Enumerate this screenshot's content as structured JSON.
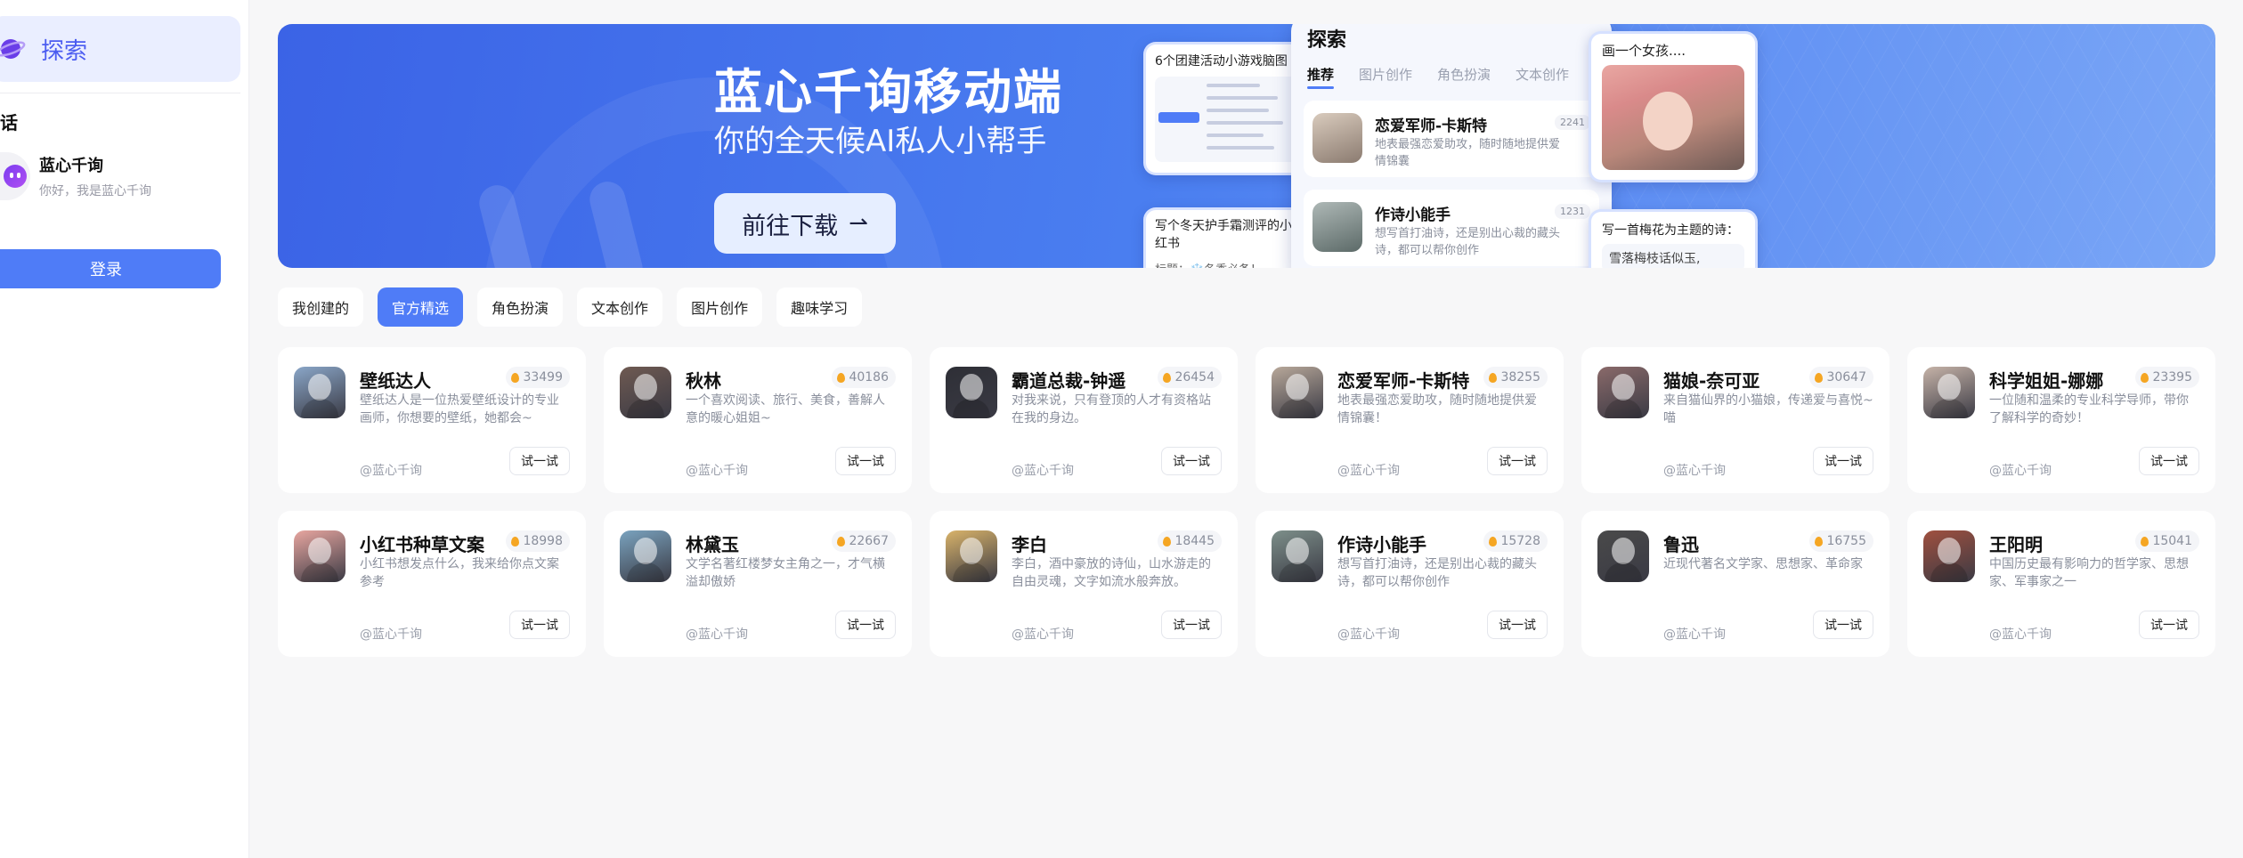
{
  "sidebar": {
    "explore_label": "探索",
    "section_title": "话",
    "chat": {
      "name": "蓝心千询",
      "subtitle": "你好，我是蓝心千询"
    },
    "login_label": "登录"
  },
  "banner": {
    "title": "蓝心千询移动端",
    "subtitle": "你的全天候AI私人小帮手",
    "download_label": "前往下载",
    "float_mind_title": "6个团建活动小游戏脑图",
    "float_xhs_title": "写个冬天护手霜测评的小红书",
    "float_xhs_snippet": "标题：❄️冬季必备！",
    "float_girl_title": "画一个女孩....",
    "float_poem_title": "写一首梅花为主题的诗：",
    "float_poem_line": "雪落梅枝话似玉,",
    "phone": {
      "title": "探索",
      "tabs": [
        "推荐",
        "图片创作",
        "角色扮演",
        "文本创作"
      ],
      "items": [
        {
          "name": "恋爱军师-卡斯特",
          "desc": "地表最强恋爱助攻，随时随地提供爱情锦囊",
          "count": "2241"
        },
        {
          "name": "作诗小能手",
          "desc": "想写首打油诗，还是别出心裁的藏头诗，都可以帮你创作",
          "count": "1231"
        }
      ]
    }
  },
  "tabs": [
    {
      "label": "我创建的",
      "active": false
    },
    {
      "label": "官方精选",
      "active": true
    },
    {
      "label": "角色扮演",
      "active": false
    },
    {
      "label": "文本创作",
      "active": false
    },
    {
      "label": "图片创作",
      "active": false
    },
    {
      "label": "趣味学习",
      "active": false
    }
  ],
  "cards": [
    {
      "name": "壁纸达人",
      "count": "33499",
      "desc": "壁纸达人是一位热爱壁纸设计的专业画师，你想要的壁纸，她都会~",
      "author": "@蓝心千询",
      "try_label": "试一试",
      "color": "#8aa6c8"
    },
    {
      "name": "秋林",
      "count": "40186",
      "desc": "一个喜欢阅读、旅行、美食，善解人意的暖心姐姐~",
      "author": "@蓝心千询",
      "try_label": "试一试",
      "color": "#6f5a52"
    },
    {
      "name": "霸道总裁-钟遥",
      "count": "26454",
      "desc": "对我来说，只有登顶的人才有资格站在我的身边。",
      "author": "@蓝心千询",
      "try_label": "试一试",
      "color": "#2e2f36"
    },
    {
      "name": "恋爱军师-卡斯特",
      "count": "38255",
      "desc": "地表最强恋爱助攻，随时随地提供爱情锦囊！",
      "author": "@蓝心千询",
      "try_label": "试一试",
      "color": "#b8a89a"
    },
    {
      "name": "猫娘-奈可亚",
      "count": "30647",
      "desc": "来自猫仙界的小猫娘，传递爱与喜悦~喵",
      "author": "@蓝心千询",
      "try_label": "试一试",
      "color": "#8a6a6a"
    },
    {
      "name": "科学姐姐-娜娜",
      "count": "23395",
      "desc": "一位随和温柔的专业科学导师，带你了解科学的奇妙！",
      "author": "@蓝心千询",
      "try_label": "试一试",
      "color": "#c6b3a8"
    },
    {
      "name": "小红书种草文案",
      "count": "18998",
      "desc": "小红书想发点什么，我来给你点文案参考",
      "author": "@蓝心千询",
      "try_label": "试一试",
      "color": "#e8a6a0"
    },
    {
      "name": "林黛玉",
      "count": "22667",
      "desc": "文学名著红楼梦女主角之一，才气横溢却傲娇",
      "author": "@蓝心千询",
      "try_label": "试一试",
      "color": "#7aa3bf"
    },
    {
      "name": "李白",
      "count": "18445",
      "desc": "李白，酒中豪放的诗仙，山水游走的自由灵魂，文字如流水般奔放。",
      "author": "@蓝心千询",
      "try_label": "试一试",
      "color": "#d9b36a"
    },
    {
      "name": "作诗小能手",
      "count": "15728",
      "desc": "想写首打油诗，还是别出心裁的藏头诗，都可以帮你创作",
      "author": "@蓝心千询",
      "try_label": "试一试",
      "color": "#7d8f8a"
    },
    {
      "name": "鲁迅",
      "count": "16755",
      "desc": "近现代著名文学家、思想家、革命家",
      "author": "@蓝心千询",
      "try_label": "试一试",
      "color": "#4a4a4a"
    },
    {
      "name": "王阳明",
      "count": "15041",
      "desc": "中国历史最有影响力的哲学家、思想家、军事家之一",
      "author": "@蓝心千询",
      "try_label": "试一试",
      "color": "#a0503f"
    }
  ],
  "colors": {
    "accent": "#4f7cf7",
    "banner": "#4a7ef0"
  }
}
